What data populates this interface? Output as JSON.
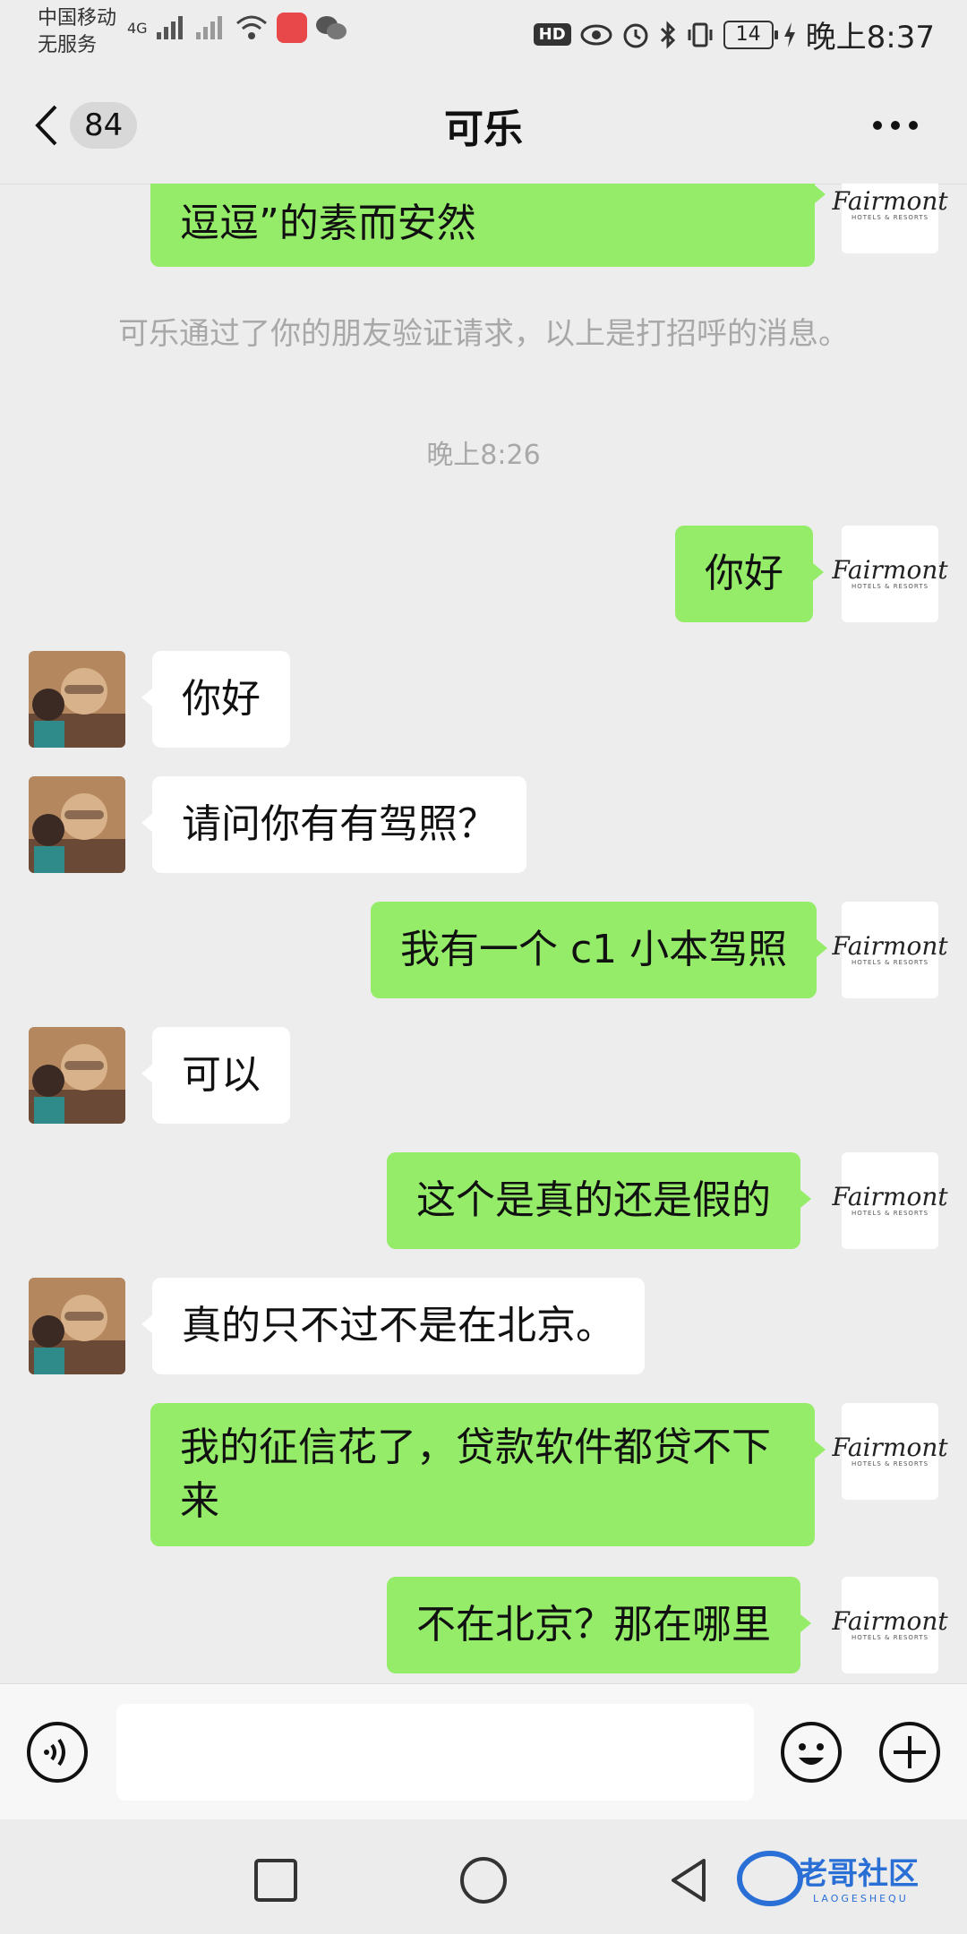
{
  "status_bar": {
    "carrier_line1": "中国移动",
    "carrier_line2": "无服务",
    "network_type": "4G",
    "hd_label": "HD",
    "battery_level": "14",
    "time": "晚上8:37"
  },
  "header": {
    "unread_count": "84",
    "title": "可乐"
  },
  "messages": [
    {
      "id": "m0",
      "side": "me",
      "text": "逗逗”的素而安然"
    },
    {
      "id": "sys1",
      "type": "system",
      "text": "可乐通过了你的朋友验证请求，以上是打招呼的消息。"
    },
    {
      "id": "t1",
      "type": "time",
      "text": "晚上8:26"
    },
    {
      "id": "m1",
      "side": "me",
      "text": "你好"
    },
    {
      "id": "m2",
      "side": "them",
      "text": "你好"
    },
    {
      "id": "m3",
      "side": "them",
      "text": "请问你有有驾照？"
    },
    {
      "id": "m4",
      "side": "me",
      "text": "我有一个 c1 小本驾照"
    },
    {
      "id": "m5",
      "side": "them",
      "text": "可以"
    },
    {
      "id": "m6",
      "side": "me",
      "text": "这个是真的还是假的"
    },
    {
      "id": "m7",
      "side": "them",
      "text": "真的只不过不是在北京。"
    },
    {
      "id": "m8",
      "side": "me",
      "text": "我的征信花了，贷款软件都贷不下来"
    },
    {
      "id": "m9",
      "side": "me",
      "text": "不在北京？那在哪里"
    }
  ],
  "my_avatar": {
    "logo": "Fairmont",
    "sub": "HOTELS & RESORTS"
  },
  "watermark": {
    "main": "老哥社区",
    "sub": "LAOGESHEQU"
  },
  "colors": {
    "my_bubble": "#95ec69",
    "their_bubble": "#ffffff",
    "background": "#ededed"
  }
}
